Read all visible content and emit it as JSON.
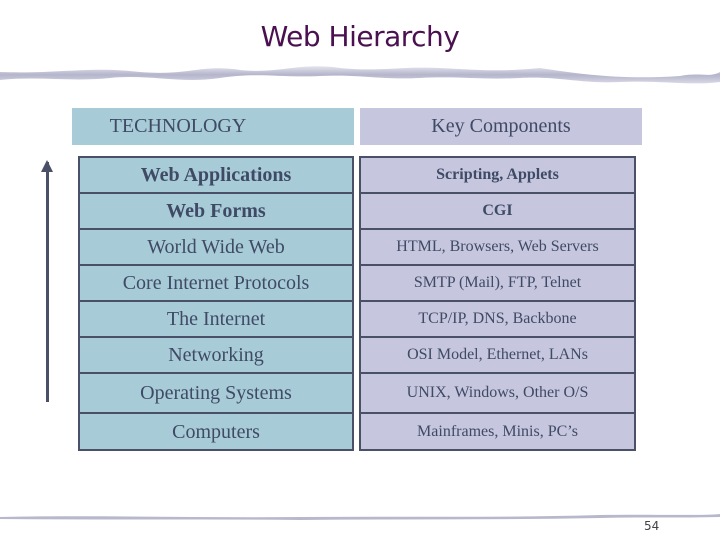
{
  "slide": {
    "title": "Web Hierarchy",
    "page_number": "54"
  },
  "headers": {
    "technology": "TECHNOLOGY",
    "key_components": "Key Components"
  },
  "rows": [
    {
      "technology": "Web Applications",
      "components": "Scripting, Applets"
    },
    {
      "technology": "Web Forms",
      "components": "CGI"
    },
    {
      "technology": "World Wide Web",
      "components": "HTML, Browsers, Web Servers"
    },
    {
      "technology": "Core Internet Protocols",
      "components": "SMTP (Mail), FTP, Telnet"
    },
    {
      "technology": "The Internet",
      "components": "TCP/IP, DNS, Backbone"
    },
    {
      "technology": "Networking",
      "components": "OSI Model, Ethernet, LANs"
    },
    {
      "technology": "Operating Systems",
      "components": "UNIX, Windows, Other O/S"
    },
    {
      "technology": "Computers",
      "components": "Mainframes, Minis, PC’s"
    }
  ],
  "colors": {
    "title": "#4a1050",
    "technology_fill": "#a8cbd8",
    "components_fill": "#c6c6de",
    "border": "#4a5068",
    "text": "#3f4a64"
  }
}
